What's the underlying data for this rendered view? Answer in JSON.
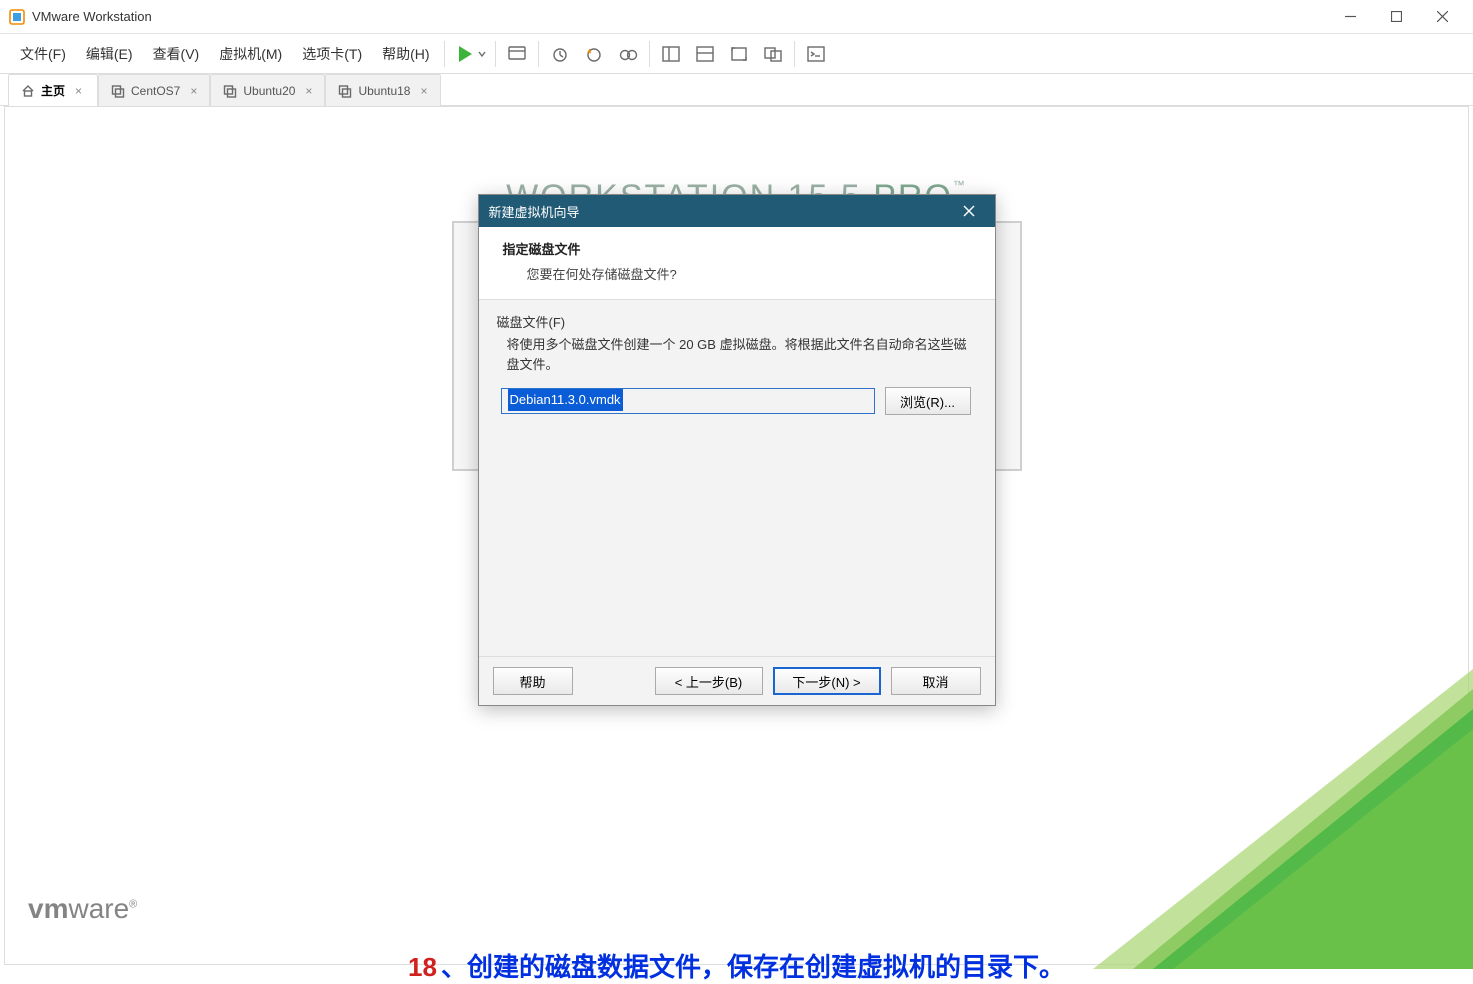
{
  "app": {
    "title": "VMware Workstation"
  },
  "menu": {
    "file": "文件(F)",
    "edit": "编辑(E)",
    "view": "查看(V)",
    "vm": "虚拟机(M)",
    "tabs": "选项卡(T)",
    "help": "帮助(H)"
  },
  "tabs": {
    "home": "主页",
    "t1": "CentOS7",
    "t2": "Ubuntu20",
    "t3": "Ubuntu18"
  },
  "bgtitle": {
    "a": "WORKSTATION ",
    "b": "15.5 ",
    "c": "PRO",
    "tm": "™"
  },
  "dialog": {
    "title": "新建虚拟机向导",
    "h1": "指定磁盘文件",
    "h2": "您要在何处存储磁盘文件?",
    "field_label": "磁盘文件(F)",
    "field_desc": "将使用多个磁盘文件创建一个 20 GB 虚拟磁盘。将根据此文件名自动命名这些磁盘文件。",
    "filename": "Debian11.3.0.vmdk",
    "browse": "浏览(R)...",
    "help": "帮助",
    "back": "< 上一步(B)",
    "next": "下一步(N) >",
    "cancel": "取消"
  },
  "annotation": {
    "step": "18",
    "sep": "、",
    "text": "创建的磁盘数据文件，保存在创建虚拟机的目录下。"
  },
  "logo": {
    "a": "vm",
    "b": "ware",
    "r": "®"
  }
}
